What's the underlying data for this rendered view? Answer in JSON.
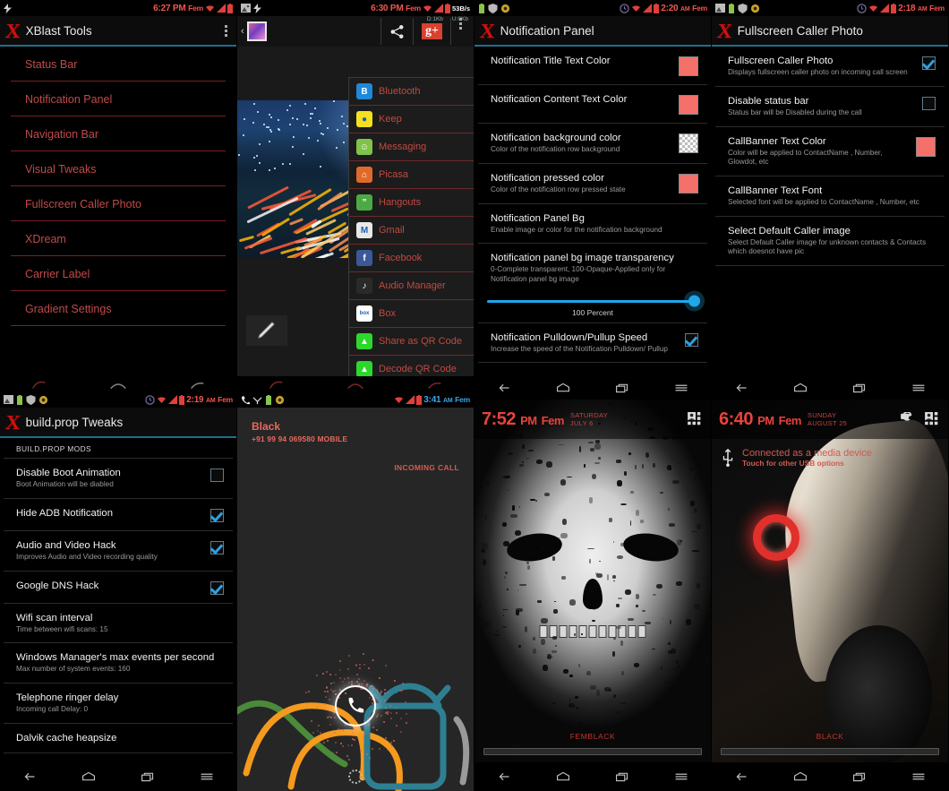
{
  "panel1": {
    "statusbar": {
      "time": "6:27",
      "meridiem": "PM",
      "carrier": "Fem"
    },
    "title": "XBlast Tools",
    "items": [
      {
        "label": "Status Bar"
      },
      {
        "label": "Notification Panel"
      },
      {
        "label": "Navigation Bar"
      },
      {
        "label": "Visual Tweaks"
      },
      {
        "label": "Fullscreen Caller Photo"
      },
      {
        "label": "XDream"
      },
      {
        "label": "Carrier Label"
      },
      {
        "label": "Gradient Settings"
      }
    ]
  },
  "panel2": {
    "statusbar": {
      "time": "6:30",
      "meridiem": "PM",
      "carrier": "Fem",
      "rate": "53B/s"
    },
    "rate_overlay": {
      "down": "D:1Kb",
      "up": "U:0Kb"
    },
    "share_menu": [
      {
        "label": "Bluetooth",
        "icon": "bluetooth-icon",
        "color": "#1f88d8",
        "glyph": "B"
      },
      {
        "label": "Keep",
        "icon": "keep-icon",
        "color": "#f5e020",
        "glyph": "●"
      },
      {
        "label": "Messaging",
        "icon": "messaging-icon",
        "color": "#7fc34a",
        "glyph": "☺"
      },
      {
        "label": "Picasa",
        "icon": "picasa-icon",
        "color": "#e06a2a",
        "glyph": "⌂"
      },
      {
        "label": "Hangouts",
        "icon": "hangouts-icon",
        "color": "#4ca944",
        "glyph": "”"
      },
      {
        "label": "Gmail",
        "icon": "gmail-icon",
        "color": "#e8e8e8",
        "glyph": "M"
      },
      {
        "label": "Facebook",
        "icon": "facebook-icon",
        "color": "#3b5998",
        "glyph": "f"
      },
      {
        "label": "Audio Manager",
        "icon": "audio-manager-icon",
        "color": "#2a2a2a",
        "glyph": "♪"
      },
      {
        "label": "Box",
        "icon": "box-icon",
        "color": "#ffffff",
        "glyph": "box"
      },
      {
        "label": "Share as QR Code",
        "icon": "qr-share-icon",
        "color": "#2bd82b",
        "glyph": "▲"
      },
      {
        "label": "Decode QR Code",
        "icon": "qr-decode-icon",
        "color": "#2bd82b",
        "glyph": "▲"
      }
    ],
    "toolbar": {
      "share_label": "share-icon",
      "gplus_label": "g+"
    }
  },
  "panel3": {
    "statusbar": {
      "time": "2:20",
      "meridiem": "AM",
      "carrier": "Fem"
    },
    "title": "Notification Panel",
    "prefs": [
      {
        "title": "Notification Title Text Color",
        "sub": "",
        "control": "swatch",
        "color": "#f4706a"
      },
      {
        "title": "Notification Content Text Color",
        "sub": "",
        "control": "swatch",
        "color": "#f4706a"
      },
      {
        "title": "Notification background color",
        "sub": "Color of the notification row background",
        "control": "checker"
      },
      {
        "title": "Notification pressed color",
        "sub": "Color of the notification row pressed state",
        "control": "swatch",
        "color": "#f4706a"
      },
      {
        "title": "Notification Panel Bg",
        "sub": "Enable image or color for the notification background",
        "control": "none"
      },
      {
        "title": "Notification panel bg image transparency",
        "sub": "0-Complete transparent, 100-Opaque-Applied only for Notification panel bg image",
        "control": "slider",
        "slider_value": 100,
        "slider_label": "100 Percent"
      },
      {
        "title": "Notification Pulldown/Pullup Speed",
        "sub": "Increase the speed of the Notification Pulldown/ Pullup",
        "control": "checkbox",
        "checked": true
      }
    ]
  },
  "panel4": {
    "statusbar": {
      "time": "2:18",
      "meridiem": "AM",
      "carrier": "Fem"
    },
    "title": "Fullscreen Caller Photo",
    "prefs": [
      {
        "title": "Fullscreen Caller Photo",
        "sub": "Displays fullscreen caller photo on incoming call screen",
        "control": "checkbox",
        "checked": true
      },
      {
        "title": "Disable status bar",
        "sub": "Status bar will be Disabled during the call",
        "control": "checkbox",
        "checked": false
      },
      {
        "title": "CallBanner Text Color",
        "sub": "Color will be applied to ContactName , Number, Glowdot, etc",
        "control": "swatch",
        "color": "#f4706a"
      },
      {
        "title": "CallBanner Text Font",
        "sub": "Selected font will be applied to ContactName , Number, etc",
        "control": "none"
      },
      {
        "title": "Select Default Caller image",
        "sub": "Select Default Caller image for unknown contacts & Contacts which doesnot have pic",
        "control": "none"
      }
    ]
  },
  "panel5": {
    "statusbar": {
      "time": "2:19",
      "meridiem": "AM",
      "carrier": "Fem"
    },
    "title": "build.prop Tweaks",
    "section": "BUILD.PROP MODS",
    "prefs": [
      {
        "title": "Disable Boot Animation",
        "sub": "Boot Animation will be diabled",
        "control": "checkbox",
        "checked": false
      },
      {
        "title": "Hide ADB Notification",
        "sub": "",
        "control": "checkbox",
        "checked": true
      },
      {
        "title": "Audio and Video Hack",
        "sub": "Improves Audio and Video recording quality",
        "control": "checkbox",
        "checked": true
      },
      {
        "title": "Google DNS Hack",
        "sub": "",
        "control": "checkbox",
        "checked": true
      },
      {
        "title": "Wifi scan interval",
        "sub": "Time between wifi scans: 15",
        "control": "none"
      },
      {
        "title": "Windows Manager's max events per second",
        "sub": "Max number of system events: 160",
        "control": "none"
      },
      {
        "title": "Telephone ringer delay",
        "sub": "Incoming call Delay: 0",
        "control": "none"
      },
      {
        "title": "Dalvik cache heapsize",
        "sub": "",
        "control": "none"
      }
    ]
  },
  "panel6": {
    "statusbar": {
      "time": "3:41",
      "meridiem": "AM",
      "carrier": "Fem"
    },
    "caller_name": "Black",
    "caller_number": "+91 99 94 069580  MOBILE",
    "call_state": "INCOMING CALL"
  },
  "panel7": {
    "time": "7:52",
    "meridiem": "PM",
    "carrier": "Fem",
    "day": "SATURDAY",
    "date": "JULY 6",
    "wallpaper_name": "FEMBLACK"
  },
  "panel8": {
    "time": "6:40",
    "meridiem": "PM",
    "carrier": "Fem",
    "day": "SUNDAY",
    "date": "AUGUST 25",
    "wallpaper_name": "BLACK",
    "usb_title": "Connected as a media device",
    "usb_sub": "Touch for other USB options"
  },
  "navbar": {
    "back": "back-icon",
    "home": "home-icon",
    "recents": "recents-icon",
    "menu": "menu-icon"
  },
  "colors": {
    "accent_red": "#cc1111",
    "text_red": "#c14a4a",
    "swatch_red": "#f4706a",
    "slider_blue": "#1fa8e8",
    "divider_blue": "#1f6f8f"
  }
}
